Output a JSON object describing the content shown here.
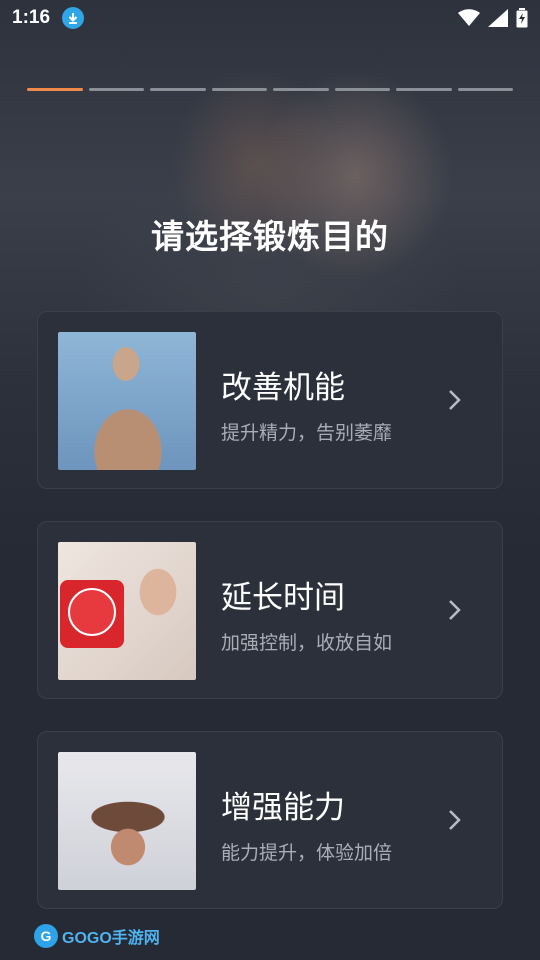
{
  "status_bar": {
    "time": "1:16",
    "icons": [
      "download-icon",
      "wifi-icon",
      "signal-icon",
      "battery-icon"
    ]
  },
  "progress": {
    "total_steps": 8,
    "current_step": 1
  },
  "title": "请选择锻炼目的",
  "options": [
    {
      "heading": "改善机能",
      "subtitle": "提升精力，告别萎靡",
      "image": "muscular-man-photo"
    },
    {
      "heading": "延长时间",
      "subtitle": "加强控制，收放自如",
      "image": "woman-with-alarm-clock-photo"
    },
    {
      "heading": "增强能力",
      "subtitle": "能力提升，体验加倍",
      "image": "woman-in-bed-photo"
    }
  ],
  "watermark": {
    "text": "GOGO手游网"
  },
  "colors": {
    "accent": "#f08a4b",
    "background": "#252a35",
    "card": "#2b303b",
    "subtitle": "#a9adb6"
  }
}
